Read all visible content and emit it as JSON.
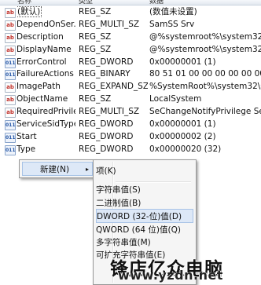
{
  "columns": {
    "name": "名称",
    "type": "类型",
    "data": "数据"
  },
  "values": [
    {
      "icon": "string-value-icon",
      "name": "(默认)",
      "type": "REG_SZ",
      "data": "(数值未设置)"
    },
    {
      "icon": "string-value-icon",
      "name": "DependOnSer...",
      "type": "REG_MULTI_SZ",
      "data": "SamSS Srv"
    },
    {
      "icon": "string-value-icon",
      "name": "Description",
      "type": "REG_SZ",
      "data": "@%systemroot%\\system32\\srv"
    },
    {
      "icon": "string-value-icon",
      "name": "DisplayName",
      "type": "REG_SZ",
      "data": "@%systemroot%\\system32\\srv"
    },
    {
      "icon": "binary-value-icon",
      "name": "ErrorControl",
      "type": "REG_DWORD",
      "data": "0x00000001 (1)"
    },
    {
      "icon": "binary-value-icon",
      "name": "FailureActions",
      "type": "REG_BINARY",
      "data": "80 51 01 00 00 00 00 00 00 00"
    },
    {
      "icon": "string-value-icon",
      "name": "ImagePath",
      "type": "REG_EXPAND_SZ",
      "data": "%SystemRoot%\\system32\\svch"
    },
    {
      "icon": "string-value-icon",
      "name": "ObjectName",
      "type": "REG_SZ",
      "data": "LocalSystem"
    },
    {
      "icon": "string-value-icon",
      "name": "RequiredPrivile...",
      "type": "REG_MULTI_SZ",
      "data": "SeChangeNotifyPrivilege SeImp"
    },
    {
      "icon": "binary-value-icon",
      "name": "ServiceSidType",
      "type": "REG_DWORD",
      "data": "0x00000001 (1)"
    },
    {
      "icon": "binary-value-icon",
      "name": "Start",
      "type": "REG_DWORD",
      "data": "0x00000002 (2)"
    },
    {
      "icon": "binary-value-icon",
      "name": "Type",
      "type": "REG_DWORD",
      "data": "0x00000020 (32)"
    }
  ],
  "context_menu": {
    "new_label": "新建(N)",
    "arrow": "▸"
  },
  "submenu": [
    {
      "label": "项(K)"
    },
    {
      "label": "字符串值(S)"
    },
    {
      "label": "二进制值(B)"
    },
    {
      "label": "DWORD (32-位)值(D)"
    },
    {
      "label": "QWORD (64 位)值(Q)"
    },
    {
      "label": "多字符串值(M)"
    },
    {
      "label": "可扩充字符串值(E)"
    }
  ],
  "icons": {
    "string-value-icon": "ab",
    "binary-value-icon": "011"
  },
  "watermark": {
    "chinese": "锋店亿众电脑",
    "url": "www.yzdn.net"
  }
}
